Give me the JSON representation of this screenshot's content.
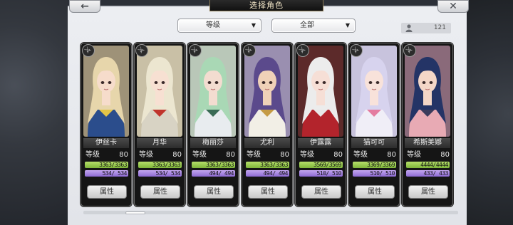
{
  "header": {
    "title": "选择角色",
    "back_glyph": "←",
    "close_glyph": "✕"
  },
  "filters": {
    "level_filter": "等级",
    "category_filter": "全部",
    "caret": "▼"
  },
  "roster_count": "121",
  "characters": [
    {
      "name": "伊丝卡",
      "level_label": "等级",
      "level": "80",
      "hp": "3363/3363",
      "mp": "534/ 534",
      "hp_fill": 1.0,
      "mp_fill": 1.0,
      "button": "属性",
      "palette": {
        "hair": "#e7d6ab",
        "skin": "#f6dccb",
        "outfit": "#2b4d8c",
        "bg": "#9e9278",
        "accent": "#e3c447"
      }
    },
    {
      "name": "月华",
      "level_label": "等级",
      "level": "80",
      "hp": "3363/3363",
      "mp": "534/ 534",
      "hp_fill": 1.0,
      "mp_fill": 1.0,
      "button": "属性",
      "palette": {
        "hair": "#ece6d0",
        "skin": "#f7e0d2",
        "outfit": "#d8d3c4",
        "bg": "#c9c0a6",
        "accent": "#c0342c"
      }
    },
    {
      "name": "梅丽莎",
      "level_label": "等级",
      "level": "80",
      "hp": "3363/3363",
      "mp": "494/ 494",
      "hp_fill": 1.0,
      "mp_fill": 1.0,
      "button": "属性",
      "palette": {
        "hair": "#a9d8b5",
        "skin": "#f3dcd0",
        "outfit": "#e8ecef",
        "bg": "#b9c7b8",
        "accent": "#3a6b55"
      }
    },
    {
      "name": "尤利",
      "level_label": "等级",
      "level": "80",
      "hp": "3363/3363",
      "mp": "494/ 494",
      "hp_fill": 1.0,
      "mp_fill": 1.0,
      "button": "属性",
      "palette": {
        "hair": "#5b4a8c",
        "skin": "#efd1b8",
        "outfit": "#f2efe6",
        "bg": "#9a8fb0",
        "accent": "#c59b45"
      }
    },
    {
      "name": "伊露露",
      "level_label": "等级",
      "level": "80",
      "hp": "3569/3569",
      "mp": "510/ 510",
      "hp_fill": 1.0,
      "mp_fill": 1.0,
      "button": "属性",
      "palette": {
        "hair": "#ececec",
        "skin": "#f6dfd6",
        "outfit": "#b3242c",
        "bg": "#5c2a2a",
        "accent": "#e8e8e8"
      }
    },
    {
      "name": "猫可可",
      "level_label": "等级",
      "level": "80",
      "hp": "3369/3369",
      "mp": "510/ 510",
      "hp_fill": 1.0,
      "mp_fill": 1.0,
      "button": "属性",
      "palette": {
        "hair": "#d7d3ee",
        "skin": "#f8e2da",
        "outfit": "#f0eef7",
        "bg": "#c8c3dd",
        "accent": "#e47ca0"
      }
    },
    {
      "name": "希斯美娜",
      "level_label": "等级",
      "level": "80",
      "hp": "4444/4444",
      "mp": "433/ 433",
      "hp_fill": 1.0,
      "mp_fill": 1.0,
      "button": "属性",
      "palette": {
        "hair": "#243466",
        "skin": "#f3d6c7",
        "outfit": "#e8aab4",
        "bg": "#8a6a7a",
        "accent": "#3b3b5c"
      }
    }
  ]
}
